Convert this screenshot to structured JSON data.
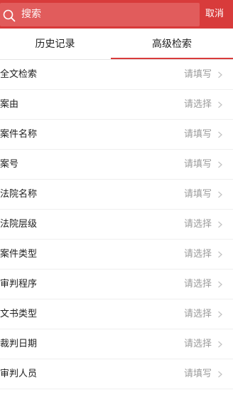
{
  "search": {
    "placeholder": "搜索",
    "cancel_label": "取消"
  },
  "tabs": [
    {
      "label": "历史记录",
      "active": false
    },
    {
      "label": "高级检索",
      "active": true
    }
  ],
  "colors": {
    "brand_red": "#d83b3b",
    "search_field": "#e15c5c",
    "placeholder_gray": "#9b9b9b"
  },
  "rows": [
    {
      "label": "全文检索",
      "value": "请填写"
    },
    {
      "label": "案由",
      "value": "请选择"
    },
    {
      "label": "案件名称",
      "value": "请填写"
    },
    {
      "label": "案号",
      "value": "请填写"
    },
    {
      "label": "法院名称",
      "value": "请填写"
    },
    {
      "label": "法院层级",
      "value": "请选择"
    },
    {
      "label": "案件类型",
      "value": "请选择"
    },
    {
      "label": "审判程序",
      "value": "请选择"
    },
    {
      "label": "文书类型",
      "value": "请选择"
    },
    {
      "label": "裁判日期",
      "value": "请选择"
    },
    {
      "label": "审判人员",
      "value": "请填写"
    }
  ]
}
